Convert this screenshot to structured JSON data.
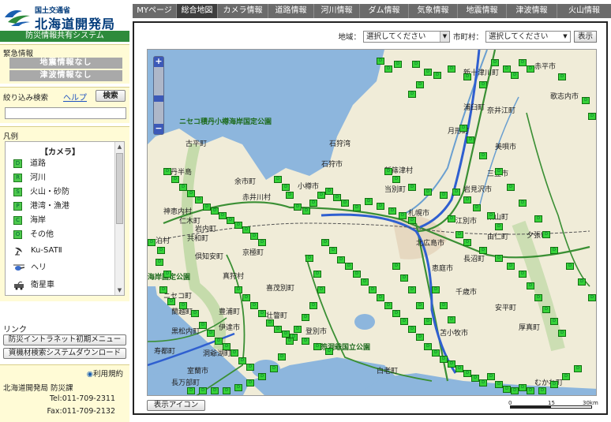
{
  "header": {
    "ministry": "国土交通省",
    "bureau": "北海道開発局",
    "system": "防災情報共有システム"
  },
  "emergency": {
    "title": "緊急情報",
    "quake": "地震情報なし",
    "tsunami": "津波情報なし"
  },
  "filter": {
    "title": "絞り込み検索",
    "help": "ヘルプ",
    "search": "検索",
    "value": ""
  },
  "legend": {
    "title": "凡例",
    "heading": "【カメラ】",
    "items": [
      {
        "code": "D",
        "label": "道路"
      },
      {
        "code": "R",
        "label": "河川"
      },
      {
        "code": "S",
        "label": "火山・砂防"
      },
      {
        "code": "P",
        "label": "港湾・漁港"
      },
      {
        "code": "C",
        "label": "海岸"
      },
      {
        "code": "O",
        "label": "その他"
      },
      {
        "code": "",
        "label": "Ku-SATⅡ"
      },
      {
        "code": "",
        "label": "ヘリ"
      },
      {
        "code": "",
        "label": "衛星車"
      }
    ]
  },
  "links": {
    "title": "リンク",
    "intranet": "防災イントラネット初期メニュー",
    "download": "資機材検索システムダウンロード"
  },
  "contact": {
    "terms": "利用規約",
    "org": "北海道開発局 防災課",
    "tel": "Tel:011-709-2311",
    "fax": "Fax:011-709-2132"
  },
  "tabs": [
    {
      "label": "MYページ",
      "active": false
    },
    {
      "label": "総合地図",
      "active": true
    },
    {
      "label": "カメラ情報",
      "active": false
    },
    {
      "label": "道路情報",
      "active": false
    },
    {
      "label": "河川情報",
      "active": false
    },
    {
      "label": "ダム情報",
      "active": false
    },
    {
      "label": "気象情報",
      "active": false
    },
    {
      "label": "地震情報",
      "active": false
    },
    {
      "label": "津波情報",
      "active": false
    },
    {
      "label": "火山情報",
      "active": false
    }
  ],
  "area": {
    "label": "地域：",
    "value": "選択してください",
    "city_label": "市町村：",
    "city_value": "選択してください",
    "show": "表示"
  },
  "map": {
    "show_icons": "表示アイコン",
    "parks": [
      "ニセコ積丹小樽海岸国定公園",
      "海岸国定公園",
      "支笏洞爺国立公園"
    ],
    "places": [
      "新十津川町",
      "赤平市",
      "月形町",
      "浦臼町",
      "歌志内市",
      "奈井江町",
      "美唄市",
      "石狩市",
      "新篠津村",
      "岩見沢市",
      "三笠市",
      "当別町",
      "積丹半島",
      "古平町",
      "余市町",
      "小樽市",
      "札幌市",
      "江別市",
      "北広島市",
      "恵庭市",
      "千歳市",
      "長沼町",
      "由仁町",
      "栗山町",
      "夕張市",
      "安平町",
      "苫小牧市",
      "白老町",
      "厚真町",
      "むかわ町",
      "伊達市",
      "室蘭市",
      "洞爺湖町",
      "京極町",
      "喜茂別町",
      "真狩村",
      "ニセコ町",
      "蘭越町",
      "寿都町",
      "黒松内町",
      "長万部町",
      "豊浦町",
      "壮瞥町",
      "倶知安町",
      "赤井川村",
      "仁木町",
      "共和町",
      "泊村",
      "岩内町",
      "神恵内村",
      "登別市",
      "石狩湾"
    ],
    "scale": [
      "0",
      "15",
      "30km"
    ]
  }
}
